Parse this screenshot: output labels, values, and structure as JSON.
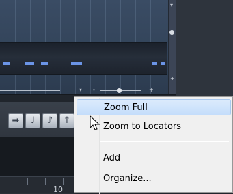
{
  "context_menu": {
    "items": [
      {
        "label": "Zoom Full",
        "highlighted": true
      },
      {
        "label": "Zoom to Locators",
        "highlighted": false
      },
      {
        "label": "Add",
        "highlighted": false
      },
      {
        "label": "Organize...",
        "highlighted": false
      }
    ]
  },
  "editor": {
    "zoom_minus": "-",
    "zoom_plus": "+"
  },
  "ruler": {
    "marker": "10"
  },
  "colors": {
    "note": "#6b94e6",
    "menu_highlight": "#c4ddfb",
    "editor_bg": "#324359"
  },
  "toolbar": {
    "icons": [
      "arrow-right-icon",
      "note-icon",
      "step-note-icon",
      "more-icon"
    ]
  }
}
